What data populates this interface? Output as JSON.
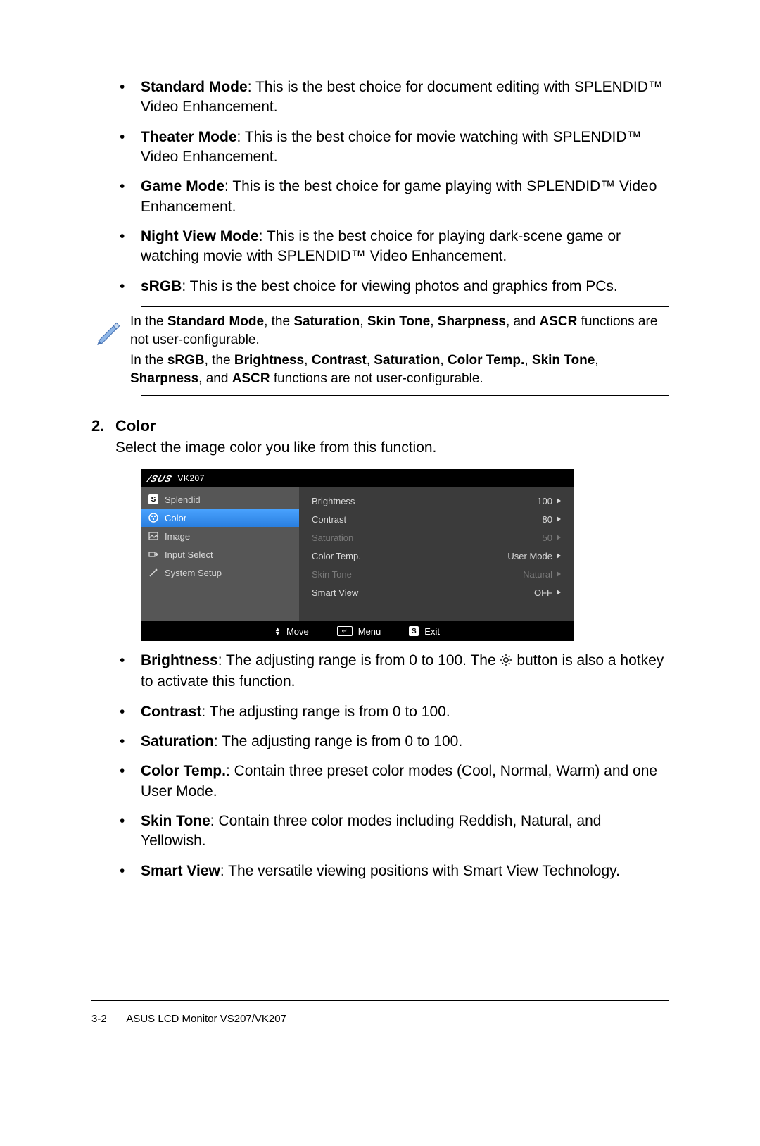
{
  "modes": {
    "standard": {
      "title": "Standard Mode",
      "desc_a": ": This is the best choice for document editing with SPLENDID™ Video Enhancement."
    },
    "theater": {
      "title": "Theater Mode",
      "desc_a": ": This is the best choice for movie watching with SPLENDID™ Video Enhancement."
    },
    "game": {
      "title": "Game Mode",
      "desc_a": ": This is the best choice for game playing with SPLENDID™ Video Enhancement."
    },
    "night": {
      "title": "Night View Mode",
      "desc_a": ": This is the best choice for playing dark-scene game or watching movie with SPLENDID™ Video Enhancement."
    },
    "srgb": {
      "title": "sRGB",
      "desc_a": ": This is the best choice for viewing photos and graphics from PCs."
    }
  },
  "note": {
    "p1_a": "In the ",
    "p1_b": "Standard Mode",
    "p1_c": ", the ",
    "p1_d": "Saturation",
    "p1_e": ",  ",
    "p1_f": "Skin Tone",
    "p1_g": ", ",
    "p1_h": "Sharpness",
    "p1_i": ", and ",
    "p1_j": "ASCR",
    "p1_k": " functions are not user-configurable.",
    "p2_a": "In the ",
    "p2_b": "sRGB",
    "p2_c": ", the ",
    "p2_d": "Brightness",
    "p2_e": ", ",
    "p2_f": "Contrast",
    "p2_g": ", ",
    "p2_h": "Saturation",
    "p2_i": ", ",
    "p2_j": "Color Temp.",
    "p2_k": ", ",
    "p2_l": "Skin Tone",
    "p2_m": ", ",
    "p2_n": "Sharpness",
    "p2_o": ", and ",
    "p2_p": "ASCR",
    "p2_q": " functions are not user-configurable."
  },
  "section2": {
    "num": "2.",
    "title": "Color",
    "body": "Select the image color you like from this function."
  },
  "osd": {
    "brand": "/SUS",
    "model": "VK207",
    "left": {
      "splendid": "Splendid",
      "color": "Color",
      "image": "Image",
      "input": "Input Select",
      "system": "System Setup"
    },
    "right": {
      "brightness": {
        "label": "Brightness",
        "value": "100"
      },
      "contrast": {
        "label": "Contrast",
        "value": "80"
      },
      "saturation": {
        "label": "Saturation",
        "value": "50"
      },
      "colortemp": {
        "label": "Color Temp.",
        "value": "User Mode"
      },
      "skintone": {
        "label": "Skin Tone",
        "value": "Natural"
      },
      "smartview": {
        "label": "Smart View",
        "value": "OFF"
      }
    },
    "footer": {
      "move": "Move",
      "menu": "Menu",
      "exit": "Exit",
      "s": "S"
    }
  },
  "color_items": {
    "brightness": {
      "title": "Brightness",
      "desc_a": ": The adjusting range is from 0 to 100. The ",
      "desc_b": " button is also a hotkey to activate this function."
    },
    "contrast": {
      "title": "Contrast",
      "desc": ": The adjusting range is from 0 to 100."
    },
    "saturation": {
      "title": "Saturation",
      "desc": ": The adjusting range is from 0 to 100."
    },
    "colortemp": {
      "title": "Color Temp.",
      "desc": ": Contain three preset color modes (Cool, Normal, Warm) and one User Mode."
    },
    "skintone": {
      "title": "Skin Tone",
      "desc": ": Contain three color modes including Reddish, Natural, and Yellowish."
    },
    "smartview": {
      "title": "Smart View",
      "desc": ": The versatile viewing positions with Smart View Technology."
    }
  },
  "footer": {
    "page": "3-2",
    "text": "ASUS LCD Monitor VS207/VK207"
  }
}
